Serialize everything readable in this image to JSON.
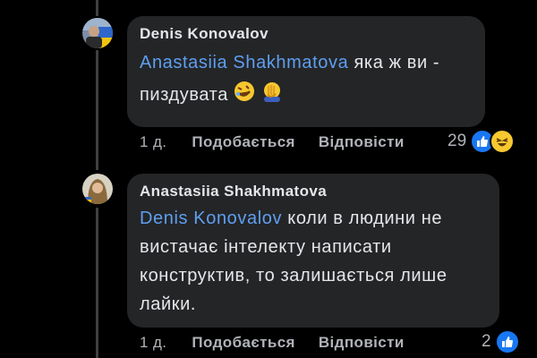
{
  "comments": [
    {
      "author": "Denis Konovalov",
      "mention": "Anastasiia Shakhmatova",
      "line1": " яка ж ви -",
      "line2": "пиздувата ",
      "time": "1 д.",
      "like_label": "Подобається",
      "reply_label": "Відповісти",
      "reaction_count": "29",
      "reactions": [
        "like-icon",
        "haha-icon"
      ]
    },
    {
      "author": "Anastasiia Shakhmatova",
      "mention": "Denis Konovalov",
      "line1": " коли в людини не",
      "line2": "вистачає інтелекту написати",
      "line3": "конструктив, то залишається лише",
      "line4": "лайки.",
      "time": "1 д.",
      "like_label": "Подобається",
      "reply_label": "Відповісти",
      "reaction_count": "2",
      "reactions": [
        "like-icon"
      ]
    }
  ],
  "colors": {
    "background": "#000000",
    "bubble": "#242526",
    "mention": "#5e9ff2",
    "muted": "#b0b3b8",
    "like_blue": "#1877f2"
  }
}
